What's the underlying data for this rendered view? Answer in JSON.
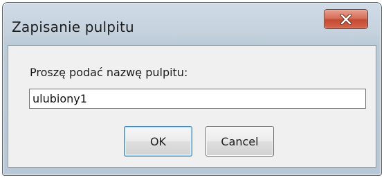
{
  "window": {
    "title": "Zapisanie pulpitu",
    "close_icon": "close-icon"
  },
  "dialog": {
    "prompt": "Proszę podać nazwę pulpitu:",
    "input_value": "ulubiony1",
    "ok_label": "OK",
    "cancel_label": "Cancel"
  },
  "colors": {
    "close_button": "#c7503a",
    "frame": "#c6d3df",
    "client_bg": "#f0f0f0"
  }
}
